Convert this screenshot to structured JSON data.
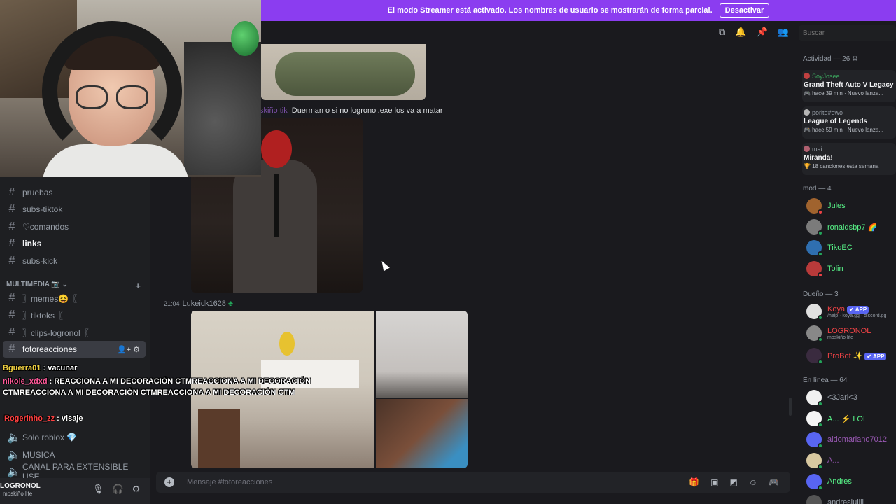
{
  "banner": {
    "text": "El modo Streamer está activado. Los nombres de usuario se mostrarán de forma parcial.",
    "button": "Desactivar"
  },
  "search": {
    "placeholder": "Buscar"
  },
  "sidebar": {
    "channels_top": [
      {
        "label": "pruebas"
      },
      {
        "label": "subs-tiktok"
      },
      {
        "label": "♡comandos"
      },
      {
        "label": "links"
      },
      {
        "label": "subs-kick"
      }
    ],
    "category": "MULTIMEDIA 📷 ⌄",
    "channels_media": [
      {
        "label": "〗memes😆〖"
      },
      {
        "label": "〗tiktoks〖"
      },
      {
        "label": "〗clips-logronol〖"
      },
      {
        "label": "fotoreacciones"
      }
    ],
    "voice_channels": [
      {
        "label": "Solo roblox 💎"
      },
      {
        "label": "MUSICA"
      },
      {
        "label": "CANAL PARA EXTENSIBLE USE..."
      }
    ],
    "user": {
      "name": "LOGRONOL",
      "status": "moskiño life"
    }
  },
  "overlay": {
    "line1_user": "Bguerra01",
    "line1_text": " : vacunar",
    "line2_user": "nikole_xdxd",
    "line2_text": " : REACCIONA A MI DECORACIÓN CTMREACCIONA A MI DECORACIÓN CTMREACCIONA A MI DECORACIÓN CTMREACCIONA A MI DECORACIÓN CTM",
    "line3_user": "Rogerinho_zz",
    "line3_text": " : visaje"
  },
  "chat": {
    "msg1_author": "skiño tik",
    "msg1_text": "Duerman o si no logronol.exe los va a matar",
    "msg2_time": "21:04",
    "msg2_author": "Lukeidk1628",
    "msg2_badge": "♣"
  },
  "composer": {
    "placeholder": "Mensaje #fotoreacciones"
  },
  "right_panel": {
    "activity_header": "Actividad — 26 ⚙",
    "activities": [
      {
        "user": "SoyJosee",
        "game": "Grand Theft Auto V Legacy",
        "sub": "🎮 hace 39 min · Nuevo lanza..."
      },
      {
        "user": "porito#owo",
        "game": "League of Legends",
        "sub": "🎮 hace 59 min · Nuevo lanza..."
      },
      {
        "user": "mai",
        "game": "Miranda!",
        "sub": "🏆 18 canciones esta semana"
      }
    ],
    "mod_header": "mod — 4",
    "mods": [
      {
        "name": "Jules",
        "color": "#57f287",
        "avatar": "#a0632e"
      },
      {
        "name": "ronaldsbp7 🌈",
        "color": "#57f287",
        "avatar": "#7b7b7b"
      },
      {
        "name": "TikoEC",
        "color": "#57f287",
        "avatar": "#2f6fb0"
      },
      {
        "name": "Tolin",
        "color": "#57f287",
        "avatar": "#b83a3a"
      }
    ],
    "owner_header": "Dueño — 3",
    "owners": [
      {
        "name": "Koya",
        "badge": "✔ APP",
        "sub": "/help · koya.gg · discord.gg",
        "color": "#ed4245",
        "avatar": "#e0e0e0"
      },
      {
        "name": "LOGRONOL",
        "badge": "",
        "sub": "moskiño life",
        "color": "#ed4245",
        "avatar": "#888888"
      },
      {
        "name": "ProBot ✨",
        "badge": "✔ APP",
        "sub": "",
        "color": "#ed4245",
        "avatar": "#3a2b3f"
      }
    ],
    "online_header": "En línea — 64",
    "online": [
      {
        "name": "<3Jari<3",
        "color": "#949ba4",
        "avatar": "#f0f0f0"
      },
      {
        "name": "A... ⚡ LOL",
        "color": "#57f287",
        "avatar": "#f5f5f5"
      },
      {
        "name": "aldomariano7012",
        "color": "#9b59b6",
        "avatar": "#5865f2"
      },
      {
        "name": "A...",
        "color": "#9b59b6",
        "avatar": "#d8c8a0"
      },
      {
        "name": "Andres",
        "color": "#57f287",
        "avatar": "#5865f2"
      },
      {
        "name": "andresjuiiii",
        "color": "#949ba4",
        "avatar": "#555555"
      }
    ]
  }
}
